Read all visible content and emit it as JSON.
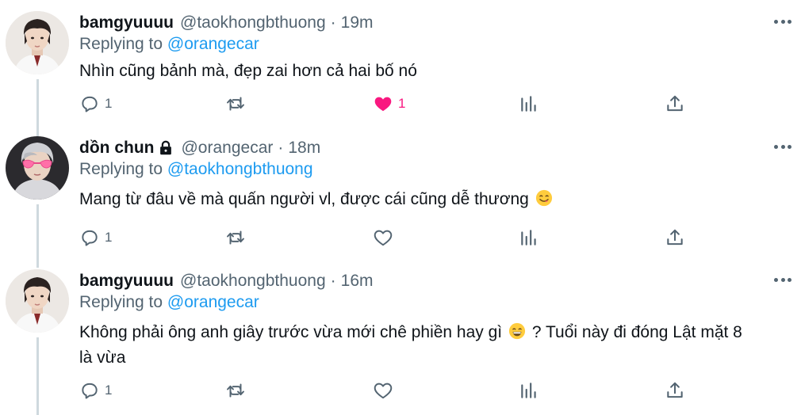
{
  "thread": {
    "tweets": [
      {
        "display_name": "bamgyuuuu",
        "handle": "@taokhongbthuong",
        "separator": "·",
        "time": "19m",
        "replying_prefix": "Replying to",
        "replying_to": "@orangecar",
        "text": "Nhìn cũng bảnh mà, đẹp zai hơn cả hai bố nó",
        "reply_count": "1",
        "like_count": "1",
        "liked": true,
        "protected": false,
        "avatar": "avatar-boy-white-shirt"
      },
      {
        "display_name": "dồn chun",
        "handle": "@orangecar",
        "separator": "·",
        "time": "18m",
        "replying_prefix": "Replying to",
        "replying_to": "@taokhongbthuong",
        "text": "Mang từ đâu về mà quấn người vl, được cái cũng dễ thương",
        "reply_count": "1",
        "like_count": "",
        "liked": false,
        "protected": true,
        "avatar": "avatar-pink-heart-glasses"
      },
      {
        "display_name": "bamgyuuuu",
        "handle": "@taokhongbthuong",
        "separator": "·",
        "time": "16m",
        "replying_prefix": "Replying to",
        "replying_to": "@orangecar",
        "text_part1": "Không phải ông anh giây trước vừa mới chê phiền hay gì",
        "text_part2": "? Tuổi này đi đóng Lật mặt 8",
        "text_line2": "là vừa",
        "reply_count": "1",
        "like_count": "",
        "liked": false,
        "protected": false,
        "avatar": "avatar-boy-white-shirt"
      }
    ]
  },
  "icons": {
    "reply": "speech-bubble-icon",
    "retweet": "retweet-icon",
    "like": "heart-icon",
    "analytics": "bar-chart-icon",
    "share": "share-icon",
    "more": "more-dots-icon",
    "lock": "lock-icon"
  },
  "colors": {
    "text": "#0f1419",
    "secondary": "#536471",
    "link": "#1d9bf0",
    "like": "#f91880",
    "rail": "#cfd9de"
  }
}
